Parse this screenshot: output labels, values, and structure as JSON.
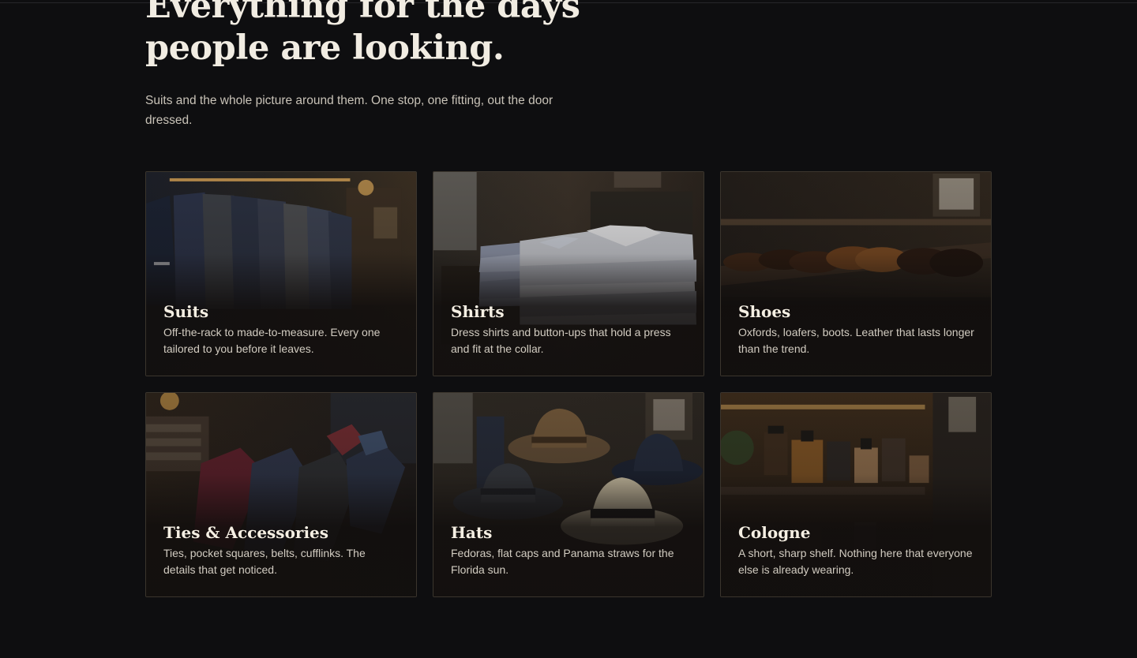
{
  "hero": {
    "headline": "Everything for the days people are looking.",
    "subtitle": "Suits and the whole picture around them. One stop, one fitting, out the door dressed."
  },
  "categories": [
    {
      "title": "Suits",
      "description": "Off-the-rack to made-to-measure. Every one tailored to you before it leaves.",
      "image_icon": "suit-rack-image"
    },
    {
      "title": "Shirts",
      "description": "Dress shirts and button-ups that hold a press and fit at the collar.",
      "image_icon": "folded-shirts-image"
    },
    {
      "title": "Shoes",
      "description": "Oxfords, loafers, boots. Leather that lasts longer than the trend.",
      "image_icon": "shoe-shelf-image"
    },
    {
      "title": "Ties & Accessories",
      "description": "Ties, pocket squares, belts, cufflinks. The details that get noticed.",
      "image_icon": "ties-image"
    },
    {
      "title": "Hats",
      "description": "Fedoras, flat caps and Panama straws for the Florida sun.",
      "image_icon": "hats-image"
    },
    {
      "title": "Cologne",
      "description": "A short, sharp shelf. Nothing here that everyone else is already wearing.",
      "image_icon": "cologne-shelf-image"
    }
  ],
  "colors": {
    "background": "#0e0e10",
    "card_border": "#3b352d",
    "heading": "#f1ece2",
    "body_text": "#c9c3b8"
  }
}
